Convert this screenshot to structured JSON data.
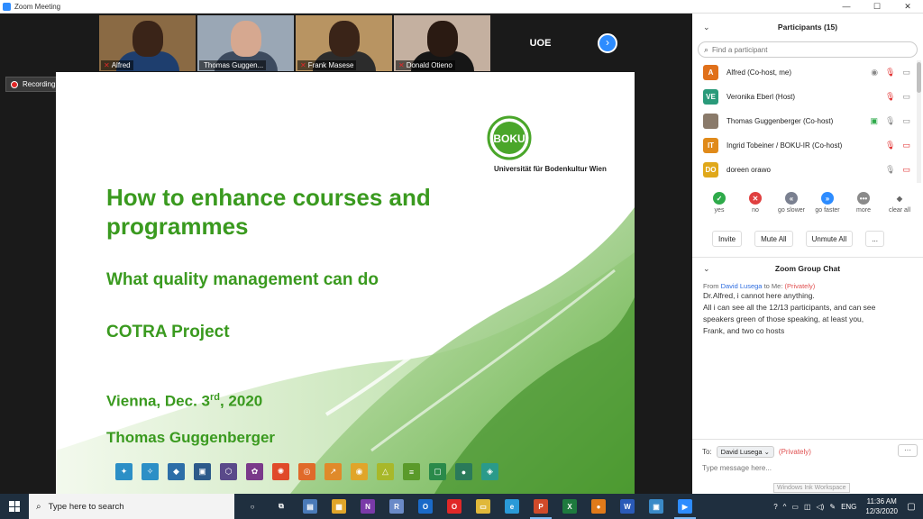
{
  "window": {
    "title": "Zoom Meeting"
  },
  "thumbnails": [
    {
      "name": "Alfred",
      "bg": "#8a6a44",
      "skin": "#3a2418",
      "shirt": "#1e3e6e",
      "muted": true
    },
    {
      "name": "Thomas Guggen...",
      "bg": "#9aa7b5",
      "skin": "#d6a890",
      "shirt": "#3c4a5e",
      "muted": false
    },
    {
      "name": "Frank Masese",
      "bg": "#b89462",
      "skin": "#3a2418",
      "shirt": "#2c2c2c",
      "muted": true
    },
    {
      "name": "Donald Otieno",
      "bg": "#c4b0a0",
      "skin": "#2a1a12",
      "shirt": "#161616",
      "muted": true
    }
  ],
  "uoe_tile": "UOE",
  "recording": {
    "label": "Recording..."
  },
  "slide": {
    "title": "How to enhance courses and programmes",
    "subtitle": "What quality management can do",
    "project": "COTRA Project",
    "date_main": "Vienna, Dec. 3",
    "date_sup": "rd",
    "date_year": ", 2020",
    "author": "Thomas Guggenberger",
    "logo_text": "BOKU",
    "logo_caption": "Universität für Bodenkultur Wien",
    "icon_colors": [
      "#2c8fc6",
      "#2c8fc6",
      "#2c6ea8",
      "#2c5a8a",
      "#5a4a8a",
      "#7a3a8a",
      "#e04a2a",
      "#e06a2a",
      "#e08a2a",
      "#e0a52a",
      "#a8b82a",
      "#5a9a2a",
      "#2a8a4a",
      "#2a7a5a",
      "#2a9a8a"
    ]
  },
  "participants": {
    "header": "Participants (15)",
    "search_placeholder": "Find a participant",
    "list": [
      {
        "initials": "A",
        "color": "#e0701a",
        "name": "Alfred (Co-host, me)",
        "mic_muted": true,
        "video_off": false
      },
      {
        "initials": "VE",
        "color": "#2a9a7a",
        "name": "Veronika Eberl (Host)",
        "mic_muted": true,
        "video_off": false
      },
      {
        "initials": "",
        "color": "#8a7a6a",
        "name": "Thomas Guggenberger (Co-host)",
        "mic_muted": false,
        "video_off": false
      },
      {
        "initials": "IT",
        "color": "#e08a1a",
        "name": "Ingrid Tobeiner / BOKU-IR (Co-host)",
        "mic_muted": true,
        "video_off": true
      },
      {
        "initials": "DO",
        "color": "#e0a81a",
        "name": "doreen orawo",
        "mic_muted": false,
        "video_off": true
      }
    ],
    "reactions": [
      {
        "label": "yes",
        "color": "#2eaa4a",
        "glyph": "✓"
      },
      {
        "label": "no",
        "color": "#e04040",
        "glyph": "✕"
      },
      {
        "label": "go slower",
        "color": "#7a8090",
        "glyph": "«"
      },
      {
        "label": "go faster",
        "color": "#2d8cff",
        "glyph": "»"
      },
      {
        "label": "more",
        "color": "#8a8a8a",
        "glyph": "•••"
      },
      {
        "label": "clear all",
        "color": "#ffffff",
        "glyph": "◆"
      }
    ],
    "buttons": {
      "invite": "Invite",
      "mute_all": "Mute All",
      "unmute_all": "Unmute All",
      "more": "..."
    }
  },
  "chat": {
    "header": "Zoom Group Chat",
    "from_prefix": "From",
    "sender": "David Lusega",
    "to_me": "to Me:",
    "privately": "(Privately)",
    "lines": [
      "Dr.Alfred, i cannot here anything.",
      "All i can see all the 12/13 participants, and can see",
      "speakers green of those speaking, at least you,",
      "Frank, and two co hosts"
    ],
    "to_label": "To:",
    "to_value": "David Lusega",
    "to_privately": "(Privately)",
    "input_placeholder": "Type message here...",
    "ink_tip": "Windows Ink Workspace",
    "more": "···"
  },
  "taskbar": {
    "search_text": "Type here to search",
    "apps": [
      {
        "name": "cortana",
        "color": "#1f2f3f",
        "glyph": "○",
        "active": false
      },
      {
        "name": "task-view",
        "color": "#1f2f3f",
        "glyph": "⧉",
        "active": false
      },
      {
        "name": "file-app",
        "color": "#4a7ab8",
        "glyph": "▤",
        "active": false
      },
      {
        "name": "store",
        "color": "#e0a52a",
        "glyph": "▦",
        "active": false
      },
      {
        "name": "onenote",
        "color": "#7a3aa8",
        "glyph": "N",
        "active": false
      },
      {
        "name": "r-app",
        "color": "#6a8ac8",
        "glyph": "R",
        "active": false
      },
      {
        "name": "outlook",
        "color": "#1a6ac8",
        "glyph": "O",
        "active": false
      },
      {
        "name": "opera",
        "color": "#e02828",
        "glyph": "O",
        "active": false
      },
      {
        "name": "explorer",
        "color": "#e0b83a",
        "glyph": "▭",
        "active": false
      },
      {
        "name": "edge",
        "color": "#2a9ad8",
        "glyph": "e",
        "active": false
      },
      {
        "name": "powerpoint",
        "color": "#d04a2a",
        "glyph": "P",
        "active": true
      },
      {
        "name": "excel",
        "color": "#1e7a3e",
        "glyph": "X",
        "active": false
      },
      {
        "name": "firefox",
        "color": "#e07a1a",
        "glyph": "●",
        "active": false
      },
      {
        "name": "word",
        "color": "#2a5ab8",
        "glyph": "W",
        "active": false
      },
      {
        "name": "photos",
        "color": "#3a8ac8",
        "glyph": "▣",
        "active": false
      },
      {
        "name": "zoom",
        "color": "#2d8cff",
        "glyph": "▶",
        "active": true
      }
    ],
    "tray_help": "?",
    "tray_lang": "ENG",
    "time": "11:36 AM",
    "date": "12/3/2020"
  }
}
